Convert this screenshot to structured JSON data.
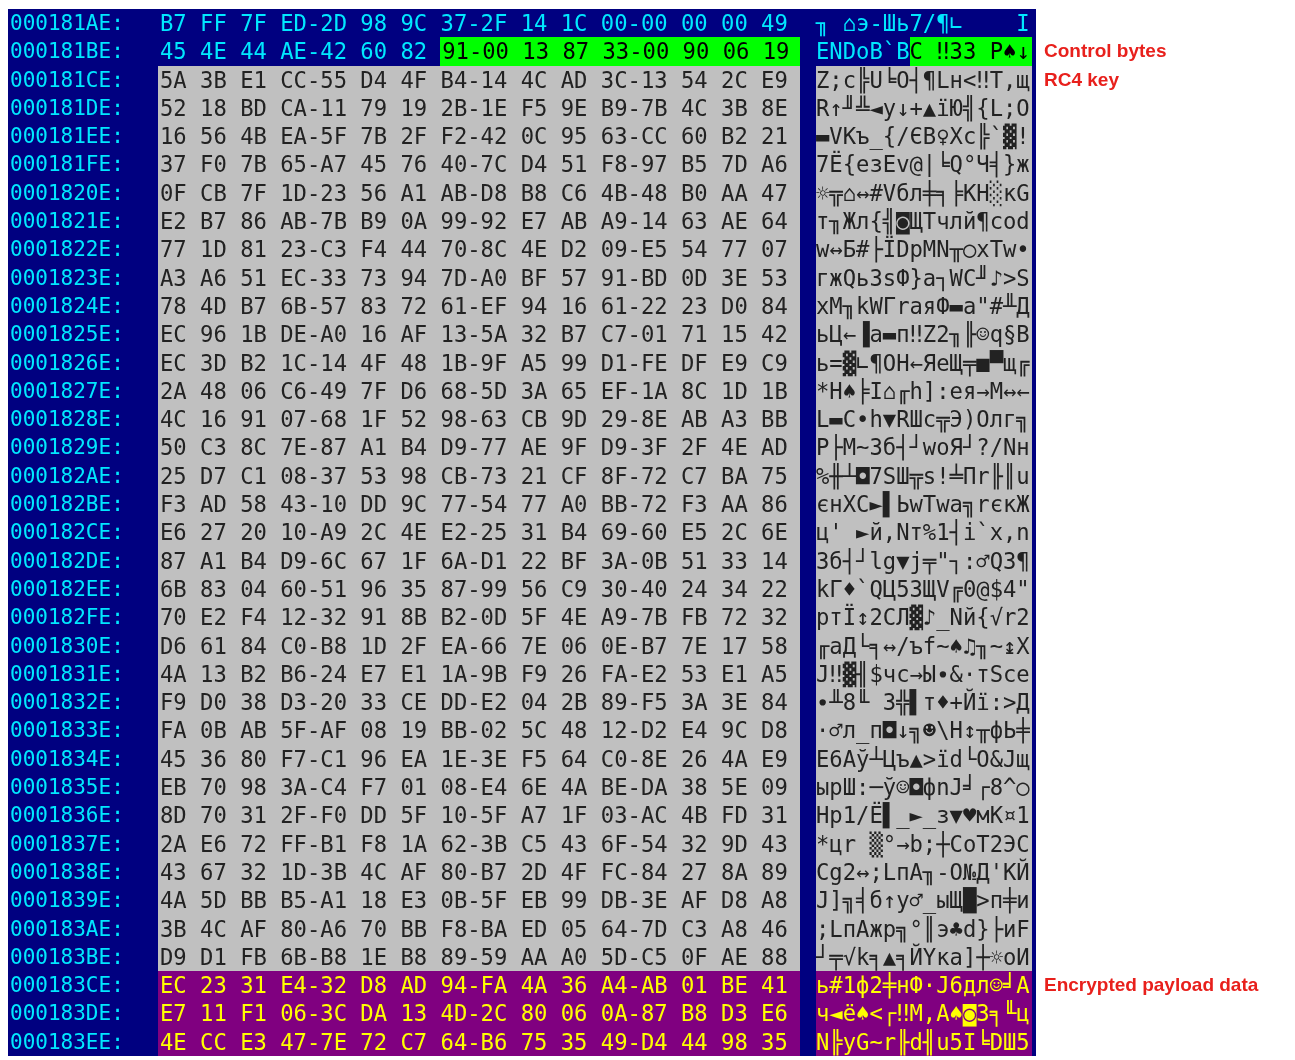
{
  "rows": [
    {
      "address": "000181AE:",
      "hex": [
        {
          "text": "B7 FF 7F ED-2D 98 9C 37-2F 14 1C 00-00 00 00 49",
          "kind": "plain"
        }
      ],
      "ascii": [
        {
          "text": "╖ ⌂э-Шь7/¶∟    I",
          "kind": "plain"
        }
      ]
    },
    {
      "address": "000181BE:",
      "hex": [
        {
          "text": "45 4E 44 AE-42 60 82",
          "kind": "plain"
        },
        {
          "text": "91-00 13 87 33-00 90 06 19",
          "kind": "control"
        }
      ],
      "ascii": [
        {
          "text": "ENDоB`В",
          "kind": "plain"
        },
        {
          "text": "С ‼З3 Р♠↓",
          "kind": "control"
        }
      ],
      "annotation": "Control bytes"
    },
    {
      "address": "000181CE:",
      "hex": [
        {
          "text": "5A 3B E1 CC-55 D4 4F B4-14 4C AD 3C-13 54 2C E9",
          "kind": "key"
        }
      ],
      "ascii": [
        {
          "text": "Z;с╠U╘O┤¶Lн<‼T,щ",
          "kind": "key"
        }
      ],
      "annotation": "RC4 key"
    },
    {
      "address": "000181DE:",
      "hex": [
        {
          "text": "52 18 BD CA-11 79 19 2B-1E F5 9E B9-7B 4C 3B 8E",
          "kind": "key"
        }
      ],
      "ascii": [
        {
          "text": "R↑╜╩◄y↓+▲їЮ╣{L;О",
          "kind": "key"
        }
      ]
    },
    {
      "address": "000181EE:",
      "hex": [
        {
          "text": "16 56 4B EA-5F 7B 2F F2-42 0C 95 63-CC 60 B2 21",
          "kind": "key"
        }
      ],
      "ascii": [
        {
          "text": "▬VKъ_{/ЄB♀Хc╠`▓!",
          "kind": "key"
        }
      ]
    },
    {
      "address": "000181FE:",
      "hex": [
        {
          "text": "37 F0 7B 65-A7 45 76 40-7C D4 51 F8-97 B5 7D A6",
          "kind": "key"
        }
      ],
      "ascii": [
        {
          "text": "7Ё{eзEv@|╘Q°Ч╡}ж",
          "kind": "key"
        }
      ]
    },
    {
      "address": "0001820E:",
      "hex": [
        {
          "text": "0F CB 7F 1D-23 56 A1 AB-D8 B8 C6 4B-48 B0 AA 47",
          "kind": "key"
        }
      ],
      "ascii": [
        {
          "text": "☼╦⌂↔#Vбл╪╕╞KH░кG",
          "kind": "key"
        }
      ]
    },
    {
      "address": "0001821E:",
      "hex": [
        {
          "text": "E2 B7 86 AB-7B B9 0A 99-92 E7 AB A9-14 63 AE 64",
          "kind": "key"
        }
      ],
      "ascii": [
        {
          "text": "т╖Жл{╣◙ЩТчлй¶cоd",
          "kind": "key"
        }
      ]
    },
    {
      "address": "0001822E:",
      "hex": [
        {
          "text": "77 1D 81 23-C3 F4 44 70-8C 4E D2 09-E5 54 77 07",
          "kind": "key"
        }
      ],
      "ascii": [
        {
          "text": "w↔Б#├ЇDpМN╥○хTw•",
          "kind": "key"
        }
      ]
    },
    {
      "address": "0001823E:",
      "hex": [
        {
          "text": "A3 A6 51 EC-33 73 94 7D-A0 BF 57 91-BD 0D 3E 53",
          "kind": "key"
        }
      ],
      "ascii": [
        {
          "text": "гжQь3sФ}а┐WС╜♪>S",
          "kind": "key"
        }
      ]
    },
    {
      "address": "0001824E:",
      "hex": [
        {
          "text": "78 4D B7 6B-57 83 72 61-EF 94 16 61-22 23 D0 84",
          "kind": "key"
        }
      ],
      "ascii": [
        {
          "text": "xM╖kWГraяФ▬a\"#╨Д",
          "kind": "key"
        }
      ]
    },
    {
      "address": "0001825E:",
      "hex": [
        {
          "text": "EC 96 1B DE-A0 16 AF 13-5A 32 B7 C7-01 71 15 42",
          "kind": "key"
        }
      ],
      "ascii": [
        {
          "text": "ьЦ←▐а▬п‼Z2╖╟☺q§B",
          "kind": "key"
        }
      ]
    },
    {
      "address": "0001826E:",
      "hex": [
        {
          "text": "EC 3D B2 1C-14 4F 48 1B-9F A5 99 D1-FE DF E9 C9",
          "kind": "key"
        }
      ],
      "ascii": [
        {
          "text": "ь=▓∟¶OH←ЯеЩ╤■▀щ╔",
          "kind": "key"
        }
      ]
    },
    {
      "address": "0001827E:",
      "hex": [
        {
          "text": "2A 48 06 C6-49 7F D6 68-5D 3A 65 EF-1A 8C 1D 1B",
          "kind": "key"
        }
      ],
      "ascii": [
        {
          "text": "*H♠╞I⌂╓h]:eя→М↔←",
          "kind": "key"
        }
      ]
    },
    {
      "address": "0001828E:",
      "hex": [
        {
          "text": "4C 16 91 07-68 1F 52 98-63 CB 9D 29-8E AB A3 BB",
          "kind": "key"
        }
      ],
      "ascii": [
        {
          "text": "L▬С•h▼RШc╦Э)Олг╗",
          "kind": "key"
        }
      ]
    },
    {
      "address": "0001829E:",
      "hex": [
        {
          "text": "50 C3 8C 7E-87 A1 B4 D9-77 AE 9F D9-3F 2F 4E AD",
          "kind": "key"
        }
      ],
      "ascii": [
        {
          "text": "P├М~Зб┤┘wоЯ┘?/Nн",
          "kind": "key"
        }
      ]
    },
    {
      "address": "000182AE:",
      "hex": [
        {
          "text": "25 D7 C1 08-37 53 98 CB-73 21 CF 8F-72 C7 BA 75",
          "kind": "key"
        }
      ],
      "ascii": [
        {
          "text": "%╫┴◘7SШ╦s!╧Пr╟║u",
          "kind": "key"
        }
      ]
    },
    {
      "address": "000182BE:",
      "hex": [
        {
          "text": "F3 AD 58 43-10 DD 9C 77-54 77 A0 BB-72 F3 AA 86",
          "kind": "key"
        }
      ],
      "ascii": [
        {
          "text": "єнXC►▌ЬwTwа╗rєкЖ",
          "kind": "key"
        }
      ]
    },
    {
      "address": "000182CE:",
      "hex": [
        {
          "text": "E6 27 20 10-A9 2C 4E E2-25 31 B4 69-60 E5 2C 6E",
          "kind": "key"
        }
      ],
      "ascii": [
        {
          "text": "ц' ►й,Nт%1┤i`х,n",
          "kind": "key"
        }
      ]
    },
    {
      "address": "000182DE:",
      "hex": [
        {
          "text": "87 A1 B4 D9-6C 67 1F 6A-D1 22 BF 3A-0B 51 33 14",
          "kind": "key"
        }
      ],
      "ascii": [
        {
          "text": "Зб┤┘lg▼j╤\"┐:♂Q3¶",
          "kind": "key"
        }
      ]
    },
    {
      "address": "000182EE:",
      "hex": [
        {
          "text": "6B 83 04 60-51 96 35 87-99 56 C9 30-40 24 34 22",
          "kind": "key"
        }
      ],
      "ascii": [
        {
          "text": "kГ♦`QЦ5ЗЩV╔0@$4\"",
          "kind": "key"
        }
      ]
    },
    {
      "address": "000182FE:",
      "hex": [
        {
          "text": "70 E2 F4 12-32 91 8B B2-0D 5F 4E A9-7B FB 72 32",
          "kind": "key"
        }
      ],
      "ascii": [
        {
          "text": "pтЇ↕2СЛ▓♪_Nй{√r2",
          "kind": "key"
        }
      ]
    },
    {
      "address": "0001830E:",
      "hex": [
        {
          "text": "D6 61 84 C0-B8 1D 2F EA-66 7E 06 0E-B7 7E 17 58",
          "kind": "key"
        }
      ],
      "ascii": [
        {
          "text": "╓aД└╕↔/ъf~♠♫╖~↨X",
          "kind": "key"
        }
      ]
    },
    {
      "address": "0001831E:",
      "hex": [
        {
          "text": "4A 13 B2 B6-24 E7 E1 1A-9B F9 26 FA-E2 53 E1 A5",
          "kind": "key"
        }
      ],
      "ascii": [
        {
          "text": "J‼▓╢$чс→Ы∙&·тSсе",
          "kind": "key"
        }
      ]
    },
    {
      "address": "0001832E:",
      "hex": [
        {
          "text": "F9 D0 38 D3-20 33 CE DD-E2 04 2B 89-F5 3A 3E 84",
          "kind": "key"
        }
      ],
      "ascii": [
        {
          "text": "∙╨8╙ 3╬▌т♦+Йї:>Д",
          "kind": "key"
        }
      ]
    },
    {
      "address": "0001833E:",
      "hex": [
        {
          "text": "FA 0B AB 5F-AF 08 19 BB-02 5C 48 12-D2 E4 9C D8",
          "kind": "key"
        }
      ],
      "ascii": [
        {
          "text": "·♂л_п◘↓╗☻\\H↕╥фЬ╪",
          "kind": "key"
        }
      ]
    },
    {
      "address": "0001834E:",
      "hex": [
        {
          "text": "45 36 80 F7-C1 96 EA 1E-3E F5 64 C0-8E 26 4A E9",
          "kind": "key"
        }
      ],
      "ascii": [
        {
          "text": "E6Аў┴Цъ▲>їd└О&Jщ",
          "kind": "key"
        }
      ]
    },
    {
      "address": "0001835E:",
      "hex": [
        {
          "text": "EB 70 98 3A-C4 F7 01 08-E4 6E 4A BE-DA 38 5E 09",
          "kind": "key"
        }
      ],
      "ascii": [
        {
          "text": "ыpШ:─ў☺◘фnJ╛┌8^○",
          "kind": "key"
        }
      ]
    },
    {
      "address": "0001836E:",
      "hex": [
        {
          "text": "8D 70 31 2F-F0 DD 5F 10-5F A7 1F 03-AC 4B FD 31",
          "kind": "key"
        }
      ],
      "ascii": [
        {
          "text": "Нp1/Ё▌_►_з▼♥мK¤1",
          "kind": "key"
        }
      ]
    },
    {
      "address": "0001837E:",
      "hex": [
        {
          "text": "2A E6 72 FF-B1 F8 1A 62-3B C5 43 6F-54 32 9D 43",
          "kind": "key"
        }
      ],
      "ascii": [
        {
          "text": "*цr ▒°→b;┼CoT2ЭC",
          "kind": "key"
        }
      ]
    },
    {
      "address": "0001838E:",
      "hex": [
        {
          "text": "43 67 32 1D-3B 4C AF 80-B7 2D 4F FC-84 27 8A 89",
          "kind": "key"
        }
      ],
      "ascii": [
        {
          "text": "Cg2↔;LпА╖-O№Д'КЙ",
          "kind": "key"
        }
      ]
    },
    {
      "address": "0001839E:",
      "hex": [
        {
          "text": "4A 5D BB B5-A1 18 E3 0B-5F EB 99 DB-3E AF D8 A8",
          "kind": "key"
        }
      ],
      "ascii": [
        {
          "text": "J]╗╡б↑у♂_ыЩ█>п╪и",
          "kind": "key"
        }
      ]
    },
    {
      "address": "000183AE:",
      "hex": [
        {
          "text": "3B 4C AF 80-A6 70 BB F8-BA ED 05 64-7D C3 A8 46",
          "kind": "key"
        }
      ],
      "ascii": [
        {
          "text": ";LпАжp╗°║э♣d}├иF",
          "kind": "key"
        }
      ]
    },
    {
      "address": "000183BE:",
      "hex": [
        {
          "text": "D9 D1 FB 6B-B8 1E B8 89-59 AA A0 5D-C5 0F AE 88",
          "kind": "key"
        }
      ],
      "ascii": [
        {
          "text": "┘╤√k╕▲╕ЙYка]┼☼оИ",
          "kind": "key"
        }
      ]
    },
    {
      "address": "000183CE:",
      "hex": [
        {
          "text": "EC 23 31 E4-32 D8 AD 94-FA 4A 36 A4-AB 01 BE 41",
          "kind": "payload"
        }
      ],
      "ascii": [
        {
          "text": "ь#1ф2╪нФ·J6дл☺╛A",
          "kind": "payload"
        }
      ],
      "annotation": "Encrypted payload data"
    },
    {
      "address": "000183DE:",
      "hex": [
        {
          "text": "E7 11 F1 06-3C DA 13 4D-2C 80 06 0A-87 B8 D3 E6",
          "kind": "payload"
        }
      ],
      "ascii": [
        {
          "text": "ч◄ё♠<┌‼M,А♠◙З╕╙ц",
          "kind": "payload"
        }
      ]
    },
    {
      "address": "000183EE:",
      "hex": [
        {
          "text": "4E CC E3 47-7E 72 C7 64-B6 75 35 49-D4 44 98 35",
          "kind": "payload"
        }
      ],
      "ascii": [
        {
          "text": "N╠уG~r╟d╢u5I╘DШ5",
          "kind": "payload"
        }
      ]
    }
  ]
}
